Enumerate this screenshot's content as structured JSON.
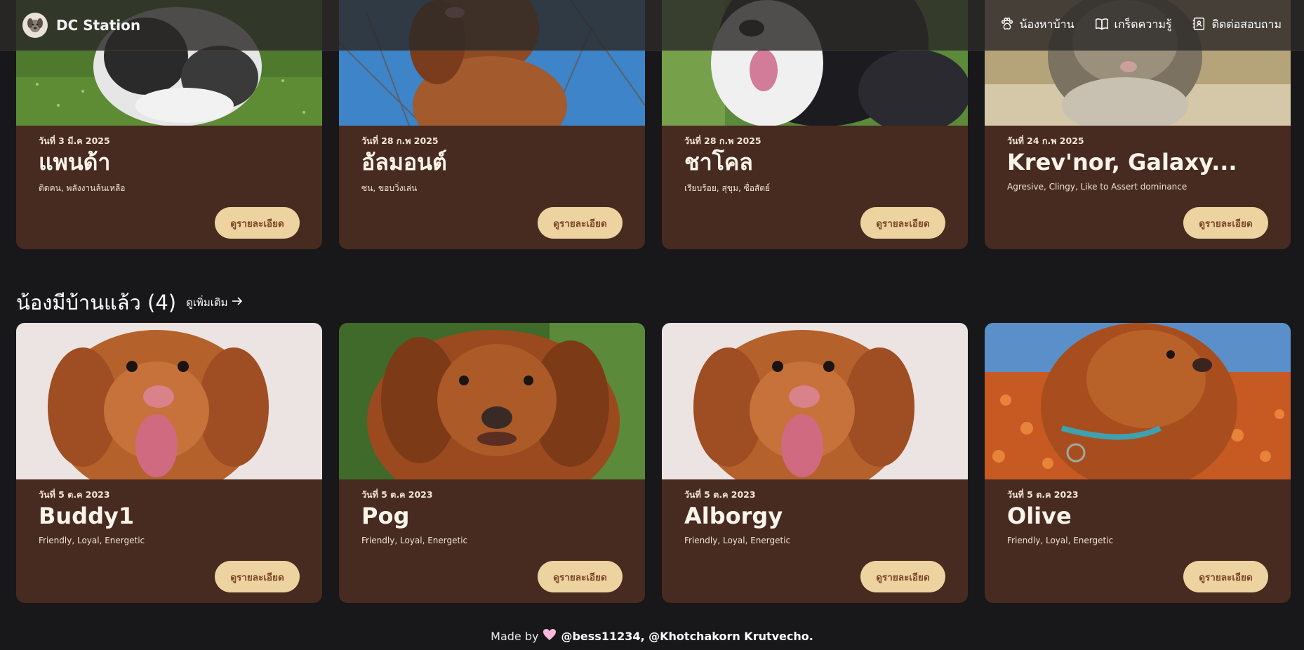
{
  "nav": {
    "brand": "DC Station",
    "links": [
      {
        "label": "น้องหาบ้าน",
        "icon": "paw-icon"
      },
      {
        "label": "เกร็ดความรู้",
        "icon": "book-icon"
      },
      {
        "label": "ติดต่อสอบถาม",
        "icon": "contact-icon"
      }
    ]
  },
  "looking_for_home": [
    {
      "date": "วันที่ 3 มี.ค 2025",
      "name": "แพนด้า",
      "tags": "ติดคน, พลังงานล้นเหลือ",
      "button": "ดูรายละเอียด"
    },
    {
      "date": "วันที่ 28 ก.พ 2025",
      "name": "อัลมอนต์",
      "tags": "ซน, ขอบวิ่งเล่น",
      "button": "ดูรายละเอียด"
    },
    {
      "date": "วันที่ 28 ก.พ 2025",
      "name": "ชาโคล",
      "tags": "เรียบร้อย, สุขุม, ซื่อสัตย์",
      "button": "ดูรายละเอียด"
    },
    {
      "date": "วันที่ 24 ก.พ 2025",
      "name": "Krev'nor, Galaxy...",
      "tags": "Agresive, Clingy, Like to Assert dominance",
      "button": "ดูรายละเอียด"
    }
  ],
  "adopted_section": {
    "title": "น้องมีบ้านแล้ว (4)",
    "see_more": "ดูเพิ่มเติม"
  },
  "adopted": [
    {
      "date": "วันที่ 5 ต.ค 2023",
      "name": "Buddy1",
      "tags": "Friendly, Loyal, Energetic",
      "button": "ดูรายละเอียด"
    },
    {
      "date": "วันที่ 5 ต.ค 2023",
      "name": "Pog",
      "tags": "Friendly, Loyal, Energetic",
      "button": "ดูรายละเอียด"
    },
    {
      "date": "วันที่ 5 ต.ค 2023",
      "name": "Alborgy",
      "tags": "Friendly, Loyal, Energetic",
      "button": "ดูรายละเอียด"
    },
    {
      "date": "วันที่ 5 ต.ค 2023",
      "name": "Olive",
      "tags": "Friendly, Loyal, Energetic",
      "button": "ดูรายละเอียด"
    }
  ],
  "footer": {
    "made_by": "Made by",
    "authors": "@bess11234, @Khotchakorn Krutvecho."
  },
  "colors": {
    "background": "#18171a",
    "card": "#472a20",
    "button": "#ecd3a0",
    "button_text": "#7b4628"
  }
}
